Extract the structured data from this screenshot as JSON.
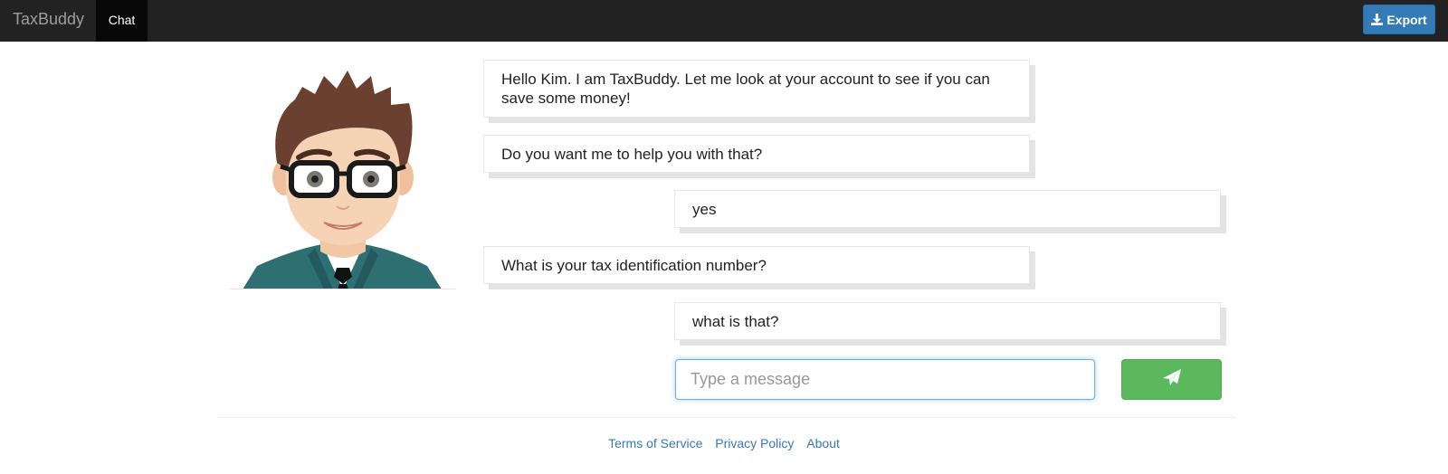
{
  "app": {
    "brand": "TaxBuddy",
    "active_tab": "Chat",
    "export_label": "Export"
  },
  "chat": {
    "messages": [
      {
        "sender": "bot",
        "text": "Hello Kim. I am TaxBuddy. Let me look at your account to see if you can save some money!"
      },
      {
        "sender": "bot",
        "text": "Do you want me to help you with that?"
      },
      {
        "sender": "user",
        "text": "yes"
      },
      {
        "sender": "bot",
        "text": "What is your tax identification number?"
      },
      {
        "sender": "user",
        "text": "what is that?"
      }
    ],
    "input_placeholder": "Type a message",
    "input_value": ""
  },
  "footer": {
    "links": [
      "Terms of Service",
      "Privacy Policy",
      "About"
    ]
  },
  "colors": {
    "navbar": "#222222",
    "active_tab": "#080808",
    "export_button": "#337ab7",
    "send_button": "#5cb85c",
    "link": "#337ab7"
  },
  "icons": {
    "export": "download-icon",
    "send": "paper-plane-icon",
    "avatar": "bot-avatar"
  }
}
